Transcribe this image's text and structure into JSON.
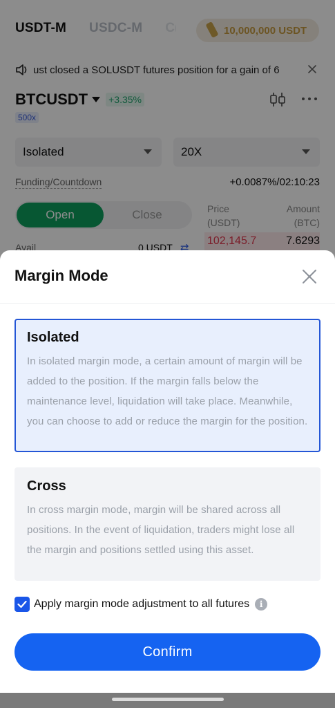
{
  "header": {
    "tabs": [
      {
        "label": "USDT-M"
      },
      {
        "label": "USDC-M"
      },
      {
        "label": "C("
      }
    ],
    "bonus": {
      "label": "10,000,000 USDT"
    }
  },
  "ticker": {
    "message": "ust closed a SOLUSDT futures position for a gain of 6"
  },
  "pair": {
    "symbol": "BTCUSDT",
    "change": "+3.35%",
    "leverage_badge": "500x"
  },
  "controls": {
    "margin_mode": "Isolated",
    "leverage": "20X"
  },
  "funding": {
    "label": "Funding/Countdown",
    "value": "+0.0087%/02:10:23"
  },
  "order_toggle": {
    "open_label": "Open",
    "close_label": "Close"
  },
  "order_book": {
    "price_header": "Price\n(USDT)",
    "amount_header": "Amount\n(BTC)",
    "top_price": "102,145.7",
    "top_amount": "7.6293"
  },
  "avail": {
    "label": "Avail",
    "value": "0 USDT"
  },
  "modal": {
    "title": "Margin Mode",
    "options": [
      {
        "title": "Isolated",
        "description": "In isolated margin mode, a certain amount of margin will be added to the position. If the margin falls below the maintenance level, liquidation will take place. Meanwhile, you can choose to add or reduce the margin for the position.",
        "selected": true
      },
      {
        "title": "Cross",
        "description": "In cross margin mode, margin will be shared across all positions. In the event of liquidation, traders might lose all the margin and positions settled using this asset.",
        "selected": false
      }
    ],
    "apply_all_label": "Apply margin mode adjustment to all futures",
    "apply_all_checked": true,
    "confirm_label": "Confirm"
  },
  "colors": {
    "accent": "#1563f1",
    "selected_border": "#2456d6",
    "selected_bg": "#e8effd",
    "positive": "#0d9f5e",
    "negative": "#e0394f"
  }
}
